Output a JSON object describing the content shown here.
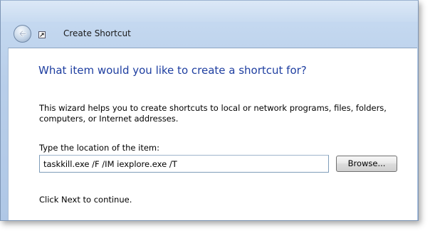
{
  "window": {
    "title": "Create Shortcut",
    "back_icon": "back-arrow-icon",
    "app_icon": "shortcut-icon"
  },
  "wizard": {
    "heading": "What item would you like to create a shortcut for?",
    "description": "This wizard helps you to create shortcuts to local or network programs, files, folders, computers, or Internet addresses.",
    "location_label": "Type the location of the item:",
    "location_value": "taskkill.exe /F /IM iexplore.exe /T",
    "browse_label": "Browse...",
    "continue_text": "Click Next to continue."
  },
  "colors": {
    "heading": "#1e3ea0",
    "frame": "#b9cfea"
  }
}
